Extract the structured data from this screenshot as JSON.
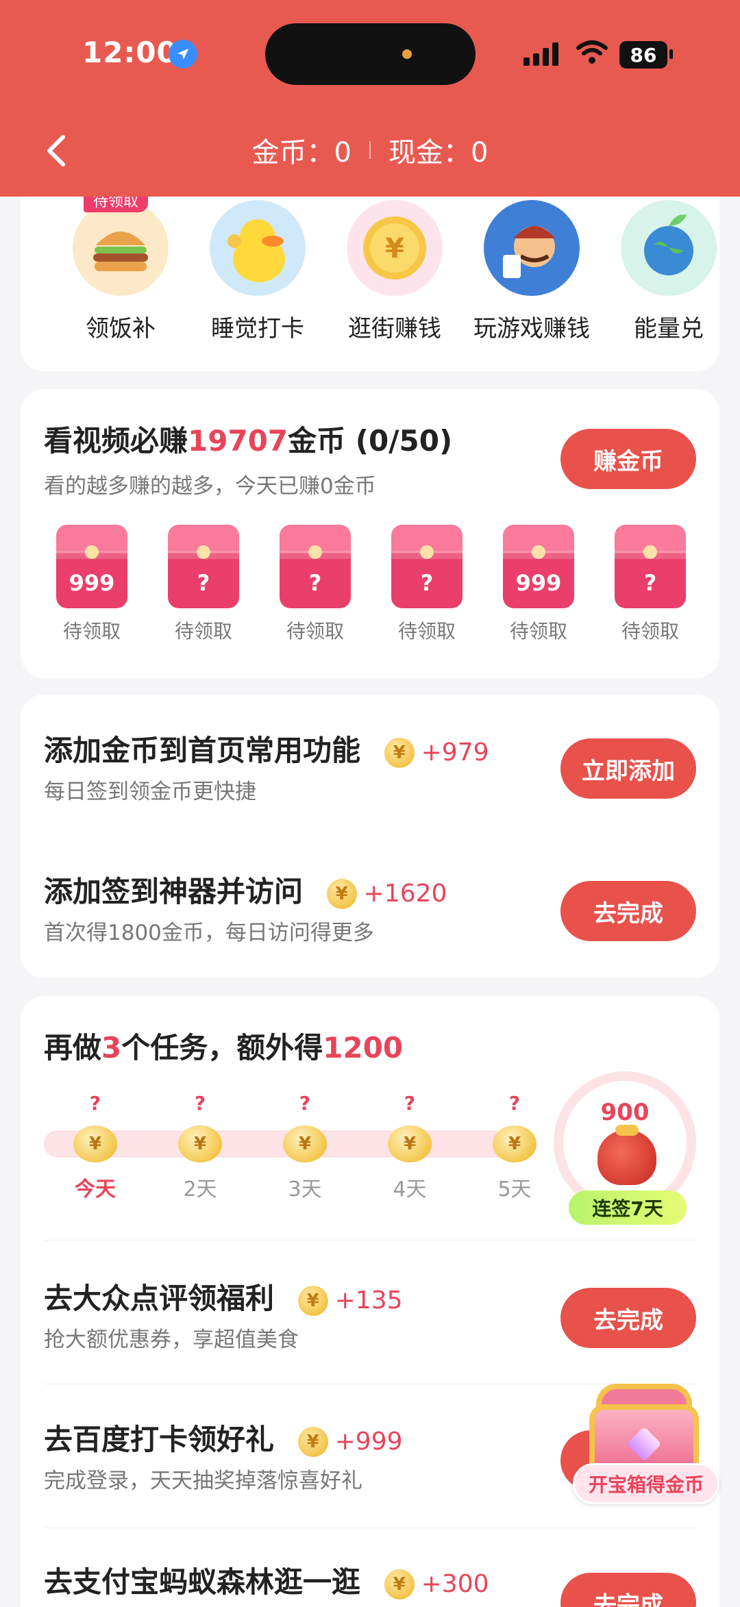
{
  "status_bar": {
    "time": "12:00",
    "battery": "86"
  },
  "header": {
    "coins_label": "金币：0",
    "cash_label": "现金：0"
  },
  "shortcuts": [
    {
      "label": "领饭补",
      "badge": "待领取"
    },
    {
      "label": "睡觉打卡"
    },
    {
      "label": "逛街赚钱"
    },
    {
      "label": "玩游戏赚钱"
    },
    {
      "label": "能量兑"
    }
  ],
  "video_card": {
    "title_pre": "看视频必赚",
    "title_num": "19707",
    "title_post": "金币 (0/50)",
    "subtitle": "看的越多赚的越多，今天已赚0金币",
    "button": "赚金币",
    "envelopes": [
      {
        "value": "999",
        "label": "待领取"
      },
      {
        "value": "?",
        "label": "待领取"
      },
      {
        "value": "?",
        "label": "待领取"
      },
      {
        "value": "?",
        "label": "待领取"
      },
      {
        "value": "999",
        "label": "待领取"
      },
      {
        "value": "?",
        "label": "待领取"
      }
    ]
  },
  "tasks_a": [
    {
      "title": "添加金币到首页常用功能",
      "coin": "¥",
      "reward": "+979",
      "subtitle": "每日签到领金币更快捷",
      "button": "立即添加"
    },
    {
      "title": "添加签到神器并访问",
      "coin": "¥",
      "reward": "+1620",
      "subtitle": "首次得1800金币，每日访问得更多",
      "button": "去完成"
    }
  ],
  "streak_card": {
    "title_pre": "再做",
    "title_num": "3",
    "title_mid": "个任务，额外得",
    "title_reward": "1200",
    "days": [
      {
        "q": "?",
        "coin": "¥",
        "label": "今天"
      },
      {
        "q": "?",
        "coin": "¥",
        "label": "2天"
      },
      {
        "q": "?",
        "coin": "¥",
        "label": "3天"
      },
      {
        "q": "?",
        "coin": "¥",
        "label": "4天"
      },
      {
        "q": "?",
        "coin": "¥",
        "label": "5天"
      }
    ],
    "bonus_value": "900",
    "streak_label": "连签7天"
  },
  "tasks_b": [
    {
      "title": "去大众点评领福利",
      "coin": "¥",
      "reward": "+135",
      "subtitle": "抢大额优惠券，享超值美食",
      "button": "去完成"
    },
    {
      "title": "去百度打卡领好礼",
      "coin": "¥",
      "reward": "+999",
      "subtitle": "完成登录，天天抽奖掉落惊喜好礼",
      "button": "去完成"
    },
    {
      "title": "去支付宝蚂蚁森林逛一逛",
      "coin": "¥",
      "reward": "+300",
      "subtitle": "",
      "button": "去完成"
    }
  ],
  "treasure": {
    "label": "开宝箱得金币"
  }
}
